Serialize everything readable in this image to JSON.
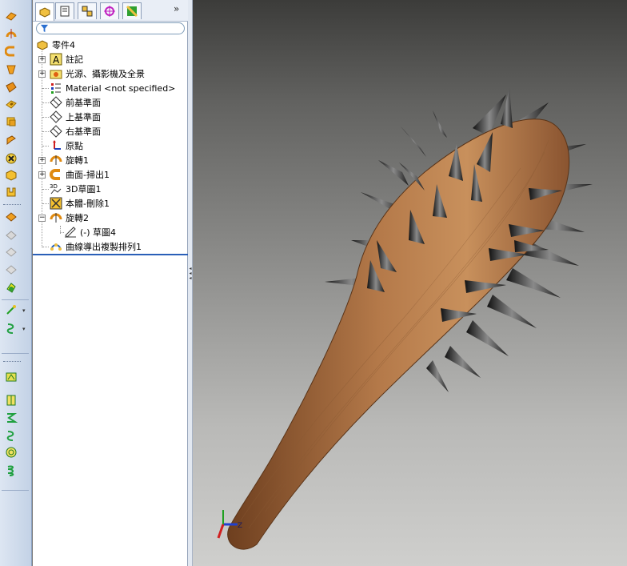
{
  "feature_tree": {
    "part_name": "零件4",
    "items": [
      {
        "label": "註記"
      },
      {
        "label": "光源、攝影機及全景"
      },
      {
        "label": "Material <not specified>"
      },
      {
        "label": "前基準面"
      },
      {
        "label": "上基準面"
      },
      {
        "label": "右基準面"
      },
      {
        "label": "原點"
      },
      {
        "label": "旋轉1"
      },
      {
        "label": "曲面-掃出1"
      },
      {
        "label": "3D草圖1"
      },
      {
        "label": "本體-刪除1"
      },
      {
        "label": "旋轉2"
      },
      {
        "label": "(-) 草圖4"
      },
      {
        "label": "曲線導出複製排列1"
      }
    ]
  },
  "panel_tabs": [
    "FeatureManager",
    "PropertyManager",
    "ConfigurationManager",
    "DimXpertManager",
    "DisplayManager"
  ],
  "panel_tabs_more": "»",
  "toolbar_icons": [
    "extruded-boss-icon",
    "revolved-boss-icon",
    "swept-boss-icon",
    "lofted-boss-icon",
    "boundary-boss-icon",
    "extruded-cut-icon",
    "revolved-cut-icon",
    "swept-cut-icon",
    "hole-wizard-icon",
    "shell-icon",
    "rib-icon",
    "fillet-icon",
    "linear-pattern-icon",
    "mirror-icon",
    "reference-geometry-icon",
    "curves-icon",
    "instant3d-icon",
    "surface-extrude-icon",
    "surface-revolve-icon",
    "surface-sweep-icon",
    "surface-loft-icon",
    "helix-icon"
  ],
  "triad_axis": "Z",
  "colors": {
    "wood": "#a0673d",
    "spike": "#2a2a2a",
    "accent": "#2a5fb8"
  }
}
